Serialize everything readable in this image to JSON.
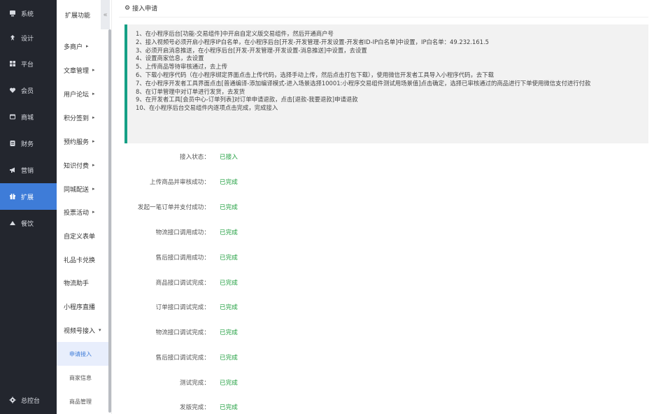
{
  "sidebar": {
    "items": [
      {
        "label": "系统",
        "icon": "monitor-icon"
      },
      {
        "label": "设计",
        "icon": "pin-icon"
      },
      {
        "label": "平台",
        "icon": "grid-icon"
      },
      {
        "label": "会员",
        "icon": "heart-icon"
      },
      {
        "label": "商城",
        "icon": "window-icon"
      },
      {
        "label": "财务",
        "icon": "ledger-icon"
      },
      {
        "label": "营销",
        "icon": "megaphone-icon"
      },
      {
        "label": "扩展",
        "icon": "gift-icon"
      },
      {
        "label": "餐饮",
        "icon": "triangle-icon"
      }
    ],
    "active_index": 7,
    "bottom": {
      "label": "总控台",
      "icon": "gear-icon"
    },
    "accent": "#3e7cd8",
    "background": "#23262e"
  },
  "submenu": {
    "title": "扩展功能",
    "collapse_glyph": "«",
    "items": [
      {
        "label": "多商户",
        "arrow": "▸"
      },
      {
        "label": "文章管理",
        "arrow": "▸"
      },
      {
        "label": "用户论坛",
        "arrow": "▸"
      },
      {
        "label": "积分签到",
        "arrow": "▸"
      },
      {
        "label": "预约服务",
        "arrow": "▸"
      },
      {
        "label": "知识付费",
        "arrow": "▸"
      },
      {
        "label": "同城配送",
        "arrow": "▸"
      },
      {
        "label": "投票活动",
        "arrow": "▸"
      },
      {
        "label": "自定义表单",
        "arrow": ""
      },
      {
        "label": "礼品卡兑换",
        "arrow": ""
      },
      {
        "label": "物流助手",
        "arrow": ""
      },
      {
        "label": "小程序直播",
        "arrow": ""
      },
      {
        "label": "视频号接入",
        "arrow": "▾"
      }
    ],
    "children": [
      {
        "label": "申请接入",
        "active": true
      },
      {
        "label": "商家信息",
        "active": false
      },
      {
        "label": "商品管理",
        "active": false
      }
    ]
  },
  "page": {
    "title": "接入申请",
    "notice_color": "#16a085",
    "notice_lines": [
      "1、在小程序后台[功能-交易组件]中开启自定义版交易组件，然后开通商户号",
      "2、接入视频号必须开启小程序IP白名单，在小程序后台[开发-开发管理-开发设置-开发者ID-IP白名单]中设置，IP白名单：49.232.161.5",
      "3、必须开启消息推送，在小程序后台[开发-开发管理-开发设置-消息推送]中设置，去设置",
      "4、设置商家信息，去设置",
      "5、上传商品等待审核通过，去上传",
      "6、下载小程序代码（在小程序绑定界面点击上传代码，选择手动上传，然后点击打包下载），使用微信开发者工具导入小程序代码，去下载",
      "7、在小程序开发者工具界面点击[普通编译-添加编译模式-进入场景选择10001:小程序交易组件测试用场景值]点击确定，选择已审核通过的商品进行下单使用微信支付进行付款",
      "8、在订单管理中对订单进行发货，去发货",
      "9、在开发者工具[会员中心-订单列表]对订单申请退款，点击[退款-我要退款]申请退款",
      "10、在小程序后台交易组件内逐项点击完成，完成接入"
    ],
    "status_color": "#1e9e3e",
    "statuses": [
      {
        "label": "接入状态：",
        "value": "已接入"
      },
      {
        "label": "上传商品并审核成功：",
        "value": "已完成"
      },
      {
        "label": "发起一笔订单并支付成功：",
        "value": "已完成"
      },
      {
        "label": "物流接口调用成功：",
        "value": "已完成"
      },
      {
        "label": "售后接口调用成功：",
        "value": "已完成"
      },
      {
        "label": "商品接口调试完成：",
        "value": "已完成"
      },
      {
        "label": "订单接口调试完成：",
        "value": "已完成"
      },
      {
        "label": "物流接口调试完成：",
        "value": "已完成"
      },
      {
        "label": "售后接口调试完成：",
        "value": "已完成"
      },
      {
        "label": "测试完成：",
        "value": "已完成"
      },
      {
        "label": "发版完成：",
        "value": "已完成"
      }
    ]
  }
}
